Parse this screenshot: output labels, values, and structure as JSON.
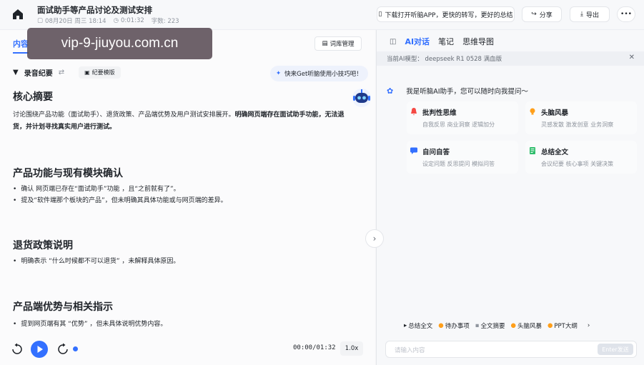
{
  "header": {
    "title": "面试助手等产品讨论及测试安排",
    "date": "08月20日 周三 18:14",
    "duration": "0:01:32",
    "word_count": "字数: 223",
    "download_app": "下载打开听脑APP，更快的转写，更好的总结",
    "share": "分享",
    "export": "导出"
  },
  "left": {
    "tabs": [
      "内容"
    ],
    "vocab_button": "词库管理",
    "recording_summary": "录音纪要",
    "template_button": "纪要模版",
    "tip": "快来Get听脑使用小技巧吧！",
    "sections": [
      {
        "heading": "核心摘要",
        "paragraph_plain": "讨论围绕产品功能（面试助手）、退货政策、产品端优势及用户测试安排展开。",
        "paragraph_bold": "明确网页端存在面试助手功能，无法退货，并计划寻找真实用户进行测试。"
      },
      {
        "heading": "产品功能与现有模块确认",
        "bullets": [
          "确认 网页端已存在“面试助手”功能 ，且“之前就有了”。",
          "提及“软件端那个板块的产品”，但未明确其具体功能或与网页端的差异。"
        ]
      },
      {
        "heading": "退货政策说明",
        "bullets": [
          "明确表示 “什么时候都不可以退货” ，未解释具体原因。"
        ]
      },
      {
        "heading": "产品端优势与相关指示",
        "bullets": [
          "提到网页端有其 “优势” ，但未具体说明优势内容。"
        ]
      }
    ]
  },
  "player": {
    "time": "00:00/01:32",
    "speed": "1.0x"
  },
  "right": {
    "tabs": [
      "AI对话",
      "笔记",
      "思维导图"
    ],
    "model_label": "当前AI模型： deepseek R1 0528 满血版",
    "greeting": "我是听脑AI助手，您可以随时向我提问～",
    "cards": [
      {
        "title": "批判性思维",
        "subtitle": "自我反思 商业洞察 逻辑加分",
        "color": "#f54a45"
      },
      {
        "title": "头脑风暴",
        "subtitle": "灵感发散 激发创意 业务洞察",
        "color": "#ff9f1a"
      },
      {
        "title": "自问自答",
        "subtitle": "设定问题 反思提问 模拟问答",
        "color": "#3370ff"
      },
      {
        "title": "总结全文",
        "subtitle": "会议纪要 核心事项 关键决策",
        "color": "#2ebd6b"
      }
    ],
    "quick_actions": [
      "总结全文",
      "待办事项",
      "全文摘要",
      "头脑风暴",
      "PPT大纲"
    ],
    "input_placeholder": "请输入内容",
    "send_label": "Enter发送"
  },
  "watermark": "vip-9-jiuyou.com.cn"
}
